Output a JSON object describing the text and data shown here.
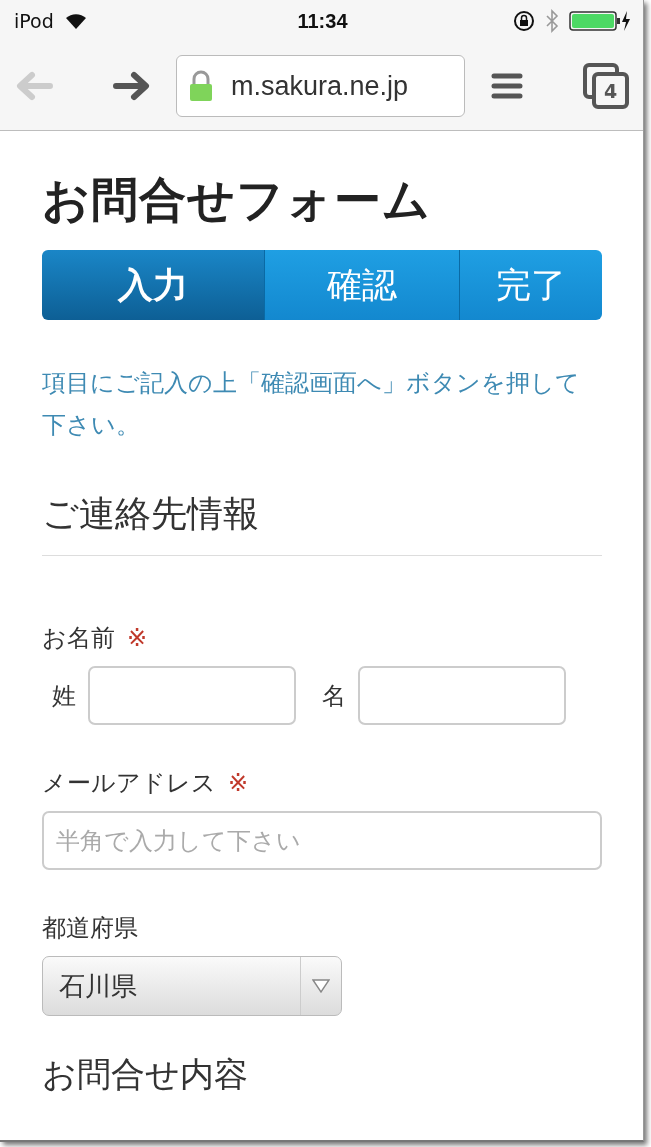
{
  "status_bar": {
    "carrier": "iPod",
    "time": "11:34"
  },
  "browser": {
    "url": "m.sakura.ne.jp",
    "tab_count": "4",
    "back_disabled": true
  },
  "title": "お問合せフォーム",
  "steps": [
    {
      "label": "入力",
      "selected": true
    },
    {
      "label": "確認",
      "selected": false
    },
    {
      "label": "完了",
      "selected": false
    }
  ],
  "instructions": "項目にご記入の上「確認画面へ」ボタンを押して下さい。",
  "section_title": "ご連絡先情報",
  "fields": [
    {
      "kind": "name",
      "label": "お名前",
      "required_mark": "※",
      "parts": [
        {
          "label": "姓"
        },
        {
          "label": "名"
        }
      ]
    },
    {
      "kind": "text",
      "label": "メールアドレス",
      "required_mark": "※",
      "placeholder": "半角で入力して下さい"
    },
    {
      "kind": "select",
      "label": "都道府県",
      "value": "石川県"
    }
  ],
  "next_section_title": "お問合せ内容"
}
